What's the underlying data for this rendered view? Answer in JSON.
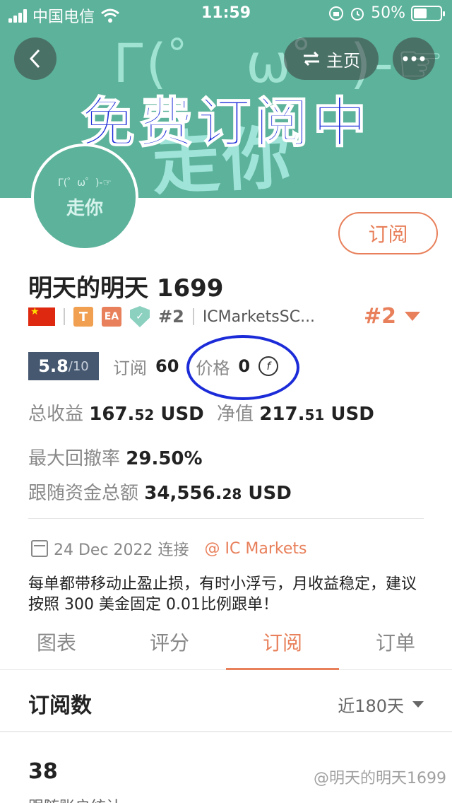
{
  "status_bar": {
    "carrier": "中国电信",
    "time": "11:59",
    "battery": "50%",
    "battery_level": 0.5
  },
  "banner": {
    "deco_face": "Γ(゜ ω゜)-☞",
    "deco_text": "走你",
    "overlay_text": "免费订阅中",
    "home_label": "主页"
  },
  "avatar": {
    "face": "Γ(゜ω゜)-☞",
    "text": "走你"
  },
  "profile": {
    "name": "明天的明天 1699",
    "subscribe_label": "订阅",
    "badges": {
      "t": "T",
      "ea": "EA",
      "rank_small": "#2",
      "broker": "ICMarketsSC..."
    },
    "rank_big": "#2"
  },
  "stats": {
    "score": "5.8",
    "score_denom": "/10",
    "subs_label": "订阅",
    "subs_value": "60",
    "price_label": "价格",
    "price_value": "0",
    "coin_symbol": "f"
  },
  "finance": {
    "total_profit_label": "总收益",
    "total_profit_int": "167.",
    "total_profit_dec": "52",
    "total_profit_unit": " USD",
    "equity_label": "净值",
    "equity_int": "217.",
    "equity_dec": "51",
    "equity_unit": " USD",
    "drawdown_label": "最大回撤率",
    "drawdown_value": "29.50%",
    "follow_label": "跟随资金总额",
    "follow_int": "34,556.",
    "follow_dec": "28",
    "follow_unit": " USD"
  },
  "connection": {
    "date_text": "24 Dec 2022 连接",
    "broker_link": "@ IC Markets"
  },
  "description": "每单都带移动止盈止损，有时小浮亏，月收益稳定，建议按照 300 美金固定 0.01比例跟单！",
  "tabs": [
    {
      "label": "图表",
      "active": false
    },
    {
      "label": "评分",
      "active": false
    },
    {
      "label": "订阅",
      "active": true
    },
    {
      "label": "订单",
      "active": false
    }
  ],
  "subscriptions": {
    "title": "订阅数",
    "range": "近180天",
    "count": "38",
    "count_label": "跟随账户统计"
  },
  "watermark": "@明天的明天1699"
}
